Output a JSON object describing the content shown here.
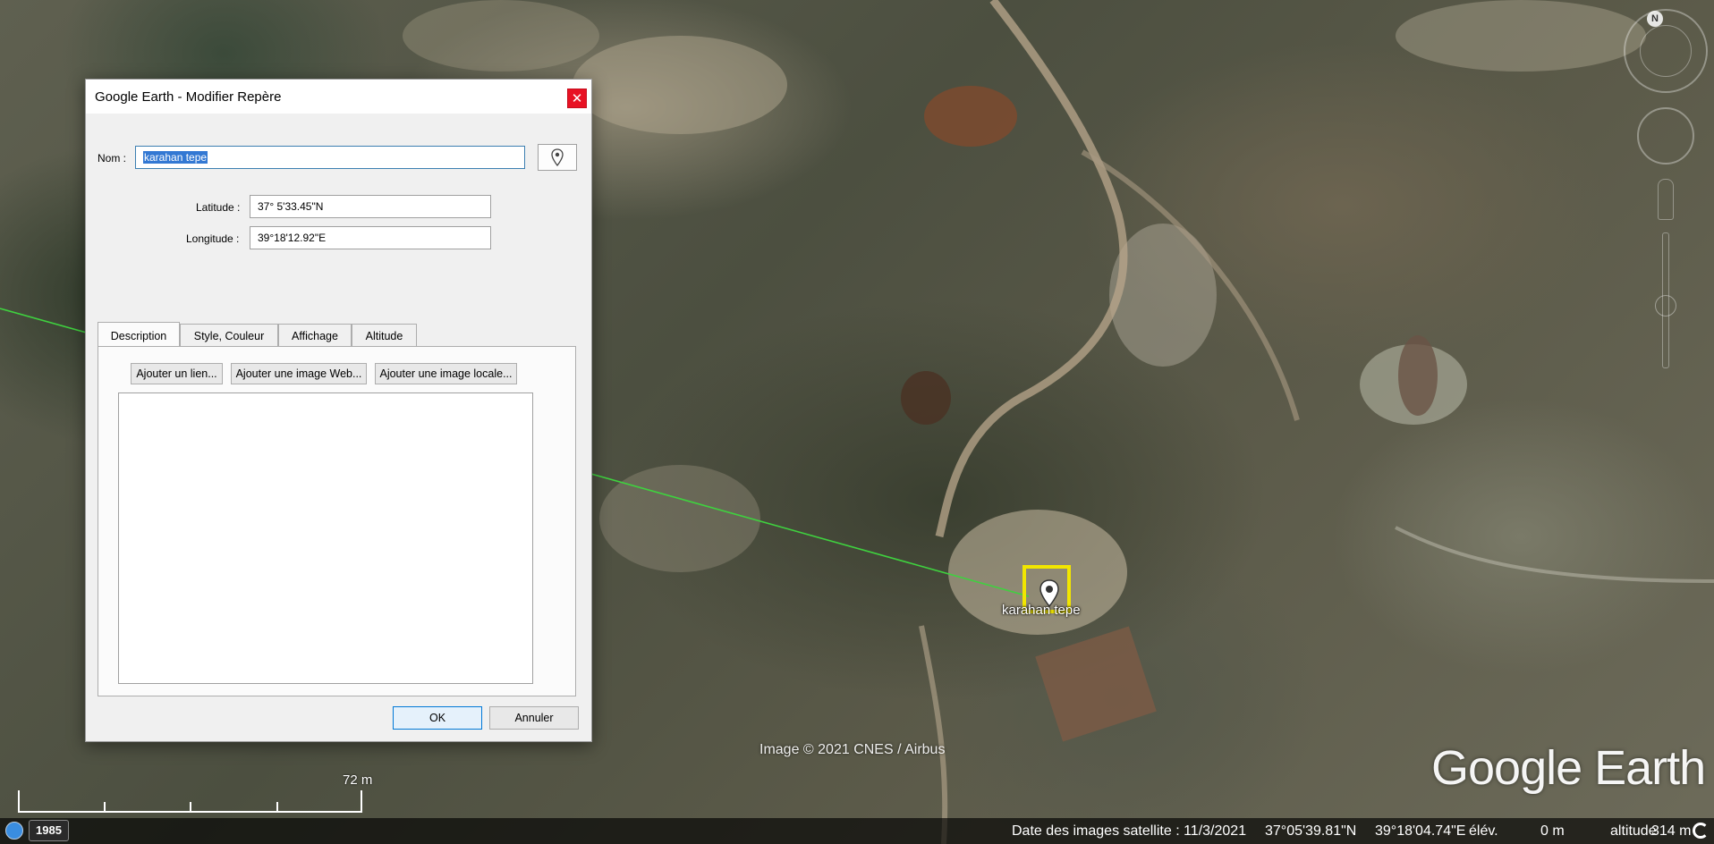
{
  "map": {
    "copyright": "Image © 2021 CNES / Airbus",
    "logo": "Google Earth",
    "placemark_label": "karahan tepe",
    "scale_label": "72  m",
    "nav": {
      "north_label": "N"
    }
  },
  "status": {
    "year": "1985",
    "imagery_date": "Date des images satellite : 11/3/2021",
    "lat": "37°05'39.81\"N",
    "lon": "39°18'04.74\"E",
    "elev_label": "élév.",
    "elev_value": "0 m",
    "alt_label": "altitude",
    "alt_value": "314 m"
  },
  "dialog": {
    "title": "Google Earth - Modifier Repère",
    "close": "✕",
    "name_label": "Nom :",
    "name_value": "karahan tepe",
    "latitude_label": "Latitude :",
    "latitude_value": "37° 5'33.45\"N",
    "longitude_label": "Longitude :",
    "longitude_value": "39°18'12.92\"E",
    "tabs": [
      {
        "label": "Description"
      },
      {
        "label": "Style, Couleur"
      },
      {
        "label": "Affichage"
      },
      {
        "label": "Altitude"
      }
    ],
    "buttons": {
      "add_link": "Ajouter un lien...",
      "add_web_image": "Ajouter une image Web...",
      "add_local_image": "Ajouter une image locale...",
      "ok": "OK",
      "cancel": "Annuler"
    }
  },
  "colors": {
    "placemark_highlight": "#f2e600",
    "path_line": "#3fd13f",
    "selection": "#3378d3",
    "close_button": "#e81123"
  }
}
